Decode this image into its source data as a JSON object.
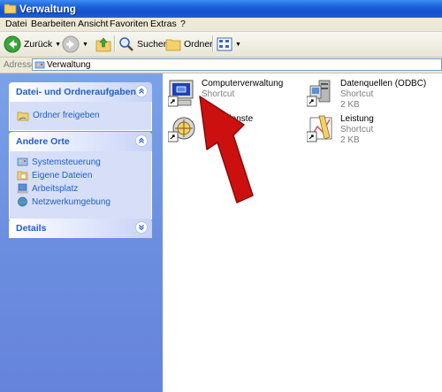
{
  "window": {
    "title": "Verwaltung"
  },
  "menu": [
    "Datei",
    "Bearbeiten",
    "Ansicht",
    "Favoriten",
    "Extras",
    "?"
  ],
  "toolbar": {
    "back_label": "Zurück",
    "search_label": "Suchen",
    "folder_label": "Ordner"
  },
  "address": {
    "label": "Adresse",
    "value": "Verwaltung"
  },
  "tasks": {
    "title": "Datei- und Ordneraufgaben",
    "items": [
      "Ordner freigeben"
    ]
  },
  "other_places": {
    "title": "Andere Orte",
    "items": [
      "Systemsteuerung",
      "Eigene Dateien",
      "Arbeitsplatz",
      "Netzwerkumgebung"
    ]
  },
  "details": {
    "title": "Details"
  },
  "files": [
    {
      "name": "Computerverwaltung",
      "type": "Shortcut",
      "size": ""
    },
    {
      "name": "Datenquellen (ODBC)",
      "type": "Shortcut",
      "size": "2 KB"
    },
    {
      "name": "tendienste",
      "type": "",
      "size": ""
    },
    {
      "name": "Leistung",
      "type": "Shortcut",
      "size": "2 KB"
    }
  ],
  "colors": {
    "titlebar": "#1552c9",
    "link": "#215dc6",
    "pane": "#6c8fe0",
    "arrow": "#cc1010"
  }
}
